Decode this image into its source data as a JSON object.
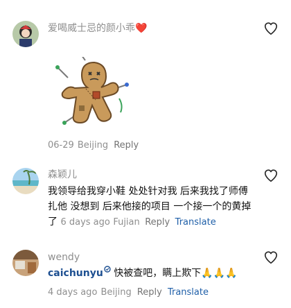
{
  "comments": [
    {
      "username": "爱喝威士忌的颜小乖",
      "username_emoji": "❤️",
      "has_sticker": true,
      "date": "06-29",
      "location": "Beijing",
      "reply_label": "Reply"
    },
    {
      "username": "森颖儿",
      "text": "我领导给我穿小鞋  处处针对我 后来我找了师傅扎他 没想到 后来他接的项目 一个接一个的黄掉了",
      "date": "6 days ago",
      "location": "Fujian",
      "reply_label": "Reply",
      "translate_label": "Translate"
    },
    {
      "username": "wendy",
      "mention": "caichunyu",
      "text": " 快被查吧，瞒上欺下🙏🙏🙏",
      "date": "4 days ago",
      "location": "Beijing",
      "reply_label": "Reply",
      "translate_label": "Translate"
    }
  ],
  "colors": {
    "meta": "#8e8e8e",
    "link_blue": "#1f5fa8",
    "mention": "#1d4f91"
  },
  "icons": {
    "like": "heart-outline-icon",
    "verified": "verified-badge-icon"
  }
}
